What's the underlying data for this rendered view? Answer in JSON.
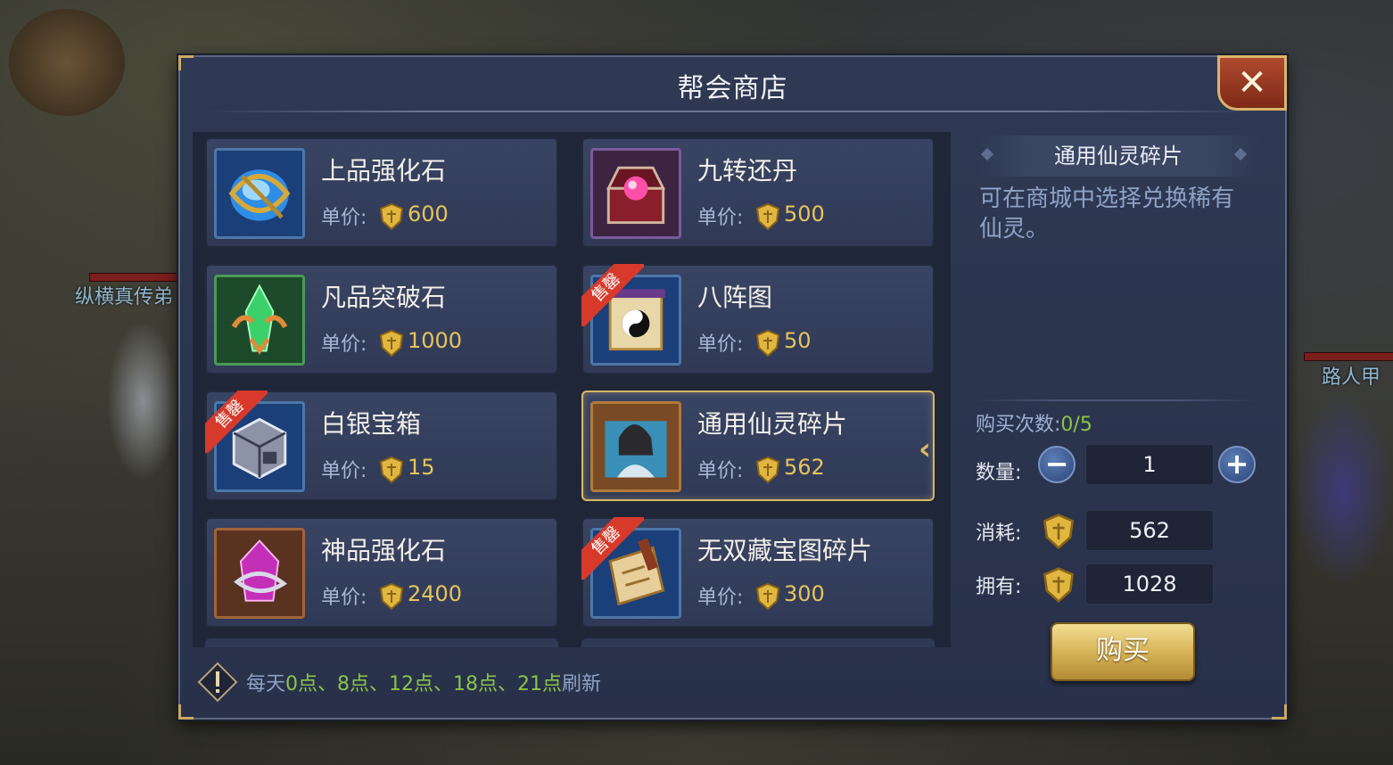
{
  "background": {
    "npc_left": "纵横真传弟",
    "npc_right": "路人甲"
  },
  "shop": {
    "title": "帮会商店",
    "close_label": "✕",
    "price_label": "单价:",
    "sold_out_label": "售罄",
    "items": [
      {
        "name": "上品强化石",
        "price": "600",
        "sold_out": false,
        "icon": "blue-gem-icon"
      },
      {
        "name": "九转还丹",
        "price": "500",
        "sold_out": false,
        "icon": "treasure-chest-orb-icon"
      },
      {
        "name": "凡品突破石",
        "price": "1000",
        "sold_out": false,
        "icon": "green-crystal-icon"
      },
      {
        "name": "八阵图",
        "price": "50",
        "sold_out": true,
        "icon": "yin-yang-scroll-icon"
      },
      {
        "name": "白银宝箱",
        "price": "15",
        "sold_out": true,
        "icon": "silver-chest-icon"
      },
      {
        "name": "通用仙灵碎片",
        "price": "562",
        "sold_out": false,
        "selected": true,
        "icon": "spirit-fragment-portrait-icon"
      },
      {
        "name": "神品强化石",
        "price": "2400",
        "sold_out": false,
        "icon": "purple-crystal-icon"
      },
      {
        "name": "无双藏宝图碎片",
        "price": "300",
        "sold_out": true,
        "icon": "treasure-map-scroll-icon"
      }
    ],
    "notice": {
      "prefix": "每天",
      "times": "0点、8点、12点、18点、21点",
      "suffix": "刷新"
    }
  },
  "detail": {
    "title": "通用仙灵碎片",
    "description": "可在商城中选择兑换稀有仙灵。",
    "buy_count_label": "购买次数:",
    "buy_count_value": "0/5",
    "quantity_label": "数量:",
    "quantity_value": "1",
    "cost_label": "消耗:",
    "cost_value": "562",
    "owned_label": "拥有:",
    "owned_value": "1028",
    "buy_button": "购买"
  },
  "colors": {
    "accent_gold": "#d8b867",
    "price_gold": "#e6c35c",
    "highlight_green": "#8bc34a",
    "sold_out_red": "#d73a2b"
  }
}
